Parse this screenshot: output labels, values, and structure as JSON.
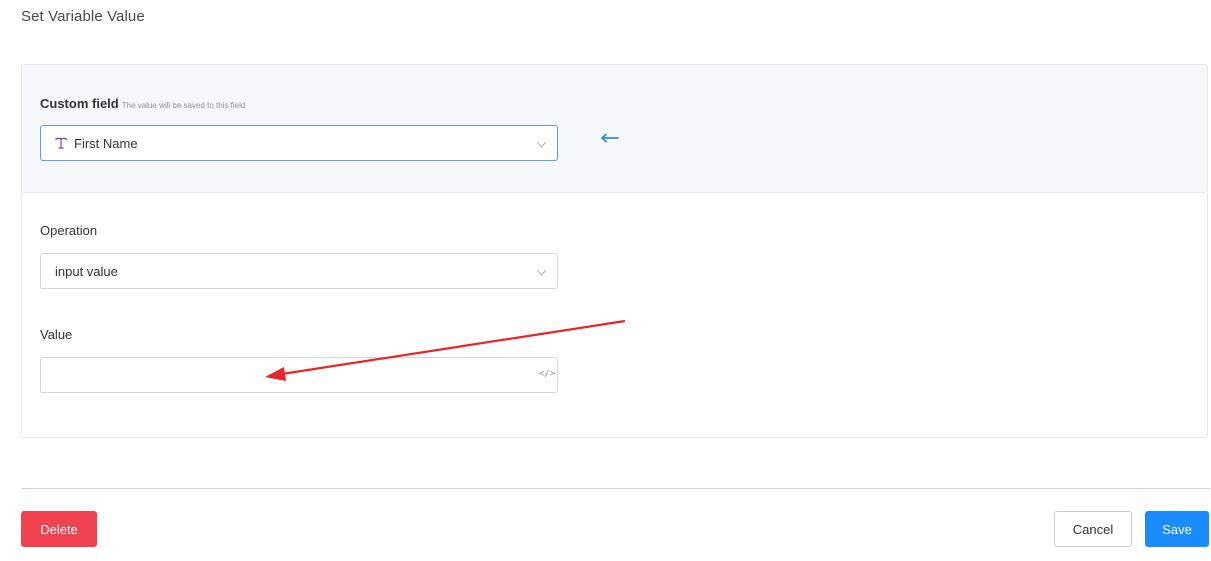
{
  "page": {
    "title": "Set Variable Value"
  },
  "custom_field": {
    "label": "Custom field",
    "hint": "The value will be saved to this field",
    "selected": "First Name",
    "type_icon": "text-type-icon"
  },
  "operation": {
    "label": "Operation",
    "selected": "input value"
  },
  "value": {
    "label": "Value",
    "input_value": "",
    "code_icon": "</>"
  },
  "actions": {
    "delete_label": "Delete",
    "cancel_label": "Cancel",
    "save_label": "Save"
  },
  "colors": {
    "accent": "#1a8cff",
    "danger": "#f1424f",
    "annotation": "#e8262a",
    "field_icon": "#7b3fbf"
  }
}
